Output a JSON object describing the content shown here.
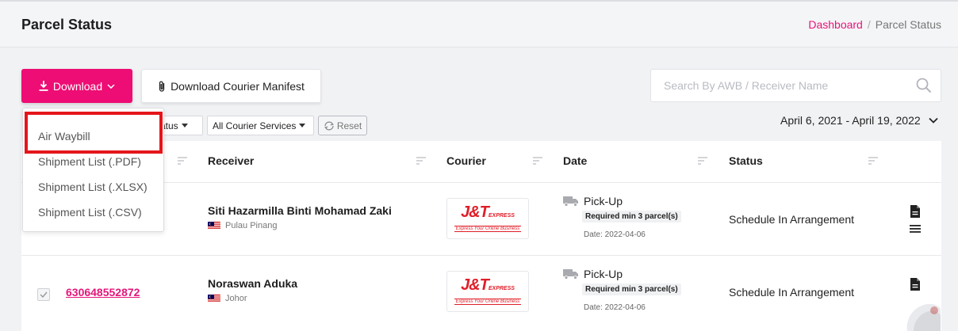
{
  "header": {
    "title": "Parcel Status",
    "breadcrumb": {
      "home": "Dashboard",
      "separator": "/",
      "current": "Parcel Status"
    }
  },
  "toolbar": {
    "download_label": "Download",
    "manifest_label": "Download Courier Manifest",
    "search_placeholder": "Search By AWB / Receiver Name"
  },
  "download_menu": {
    "items": [
      "Air Waybill",
      "Shipment List (.PDF)",
      "Shipment List (.XLSX)",
      "Shipment List (.CSV)"
    ]
  },
  "filters": {
    "status_partial": "atus",
    "courier_services": "All Courier Services",
    "reset_label": "Reset",
    "date_range": "April 6, 2021 - April 19, 2022"
  },
  "table": {
    "columns": [
      "Receiver",
      "Courier",
      "Date",
      "Status"
    ],
    "rows": [
      {
        "awb": "",
        "receiver_name": "Siti Hazarmilla Binti Mohamad Zaki",
        "receiver_state": "Pulau Pinang",
        "courier_logo_text": "J&T",
        "courier_logo_small": "EXPRESS",
        "courier_tagline": "Express Your Online Business",
        "date_type": "Pick-Up",
        "min_parcels": "Required min 3 parcel(s)",
        "date": "Date: 2022-04-06",
        "status": "Schedule In Arrangement"
      },
      {
        "awb": "630648552872",
        "receiver_name": "Noraswan Aduka",
        "receiver_state": "Johor",
        "courier_logo_text": "J&T",
        "courier_logo_small": "EXPRESS",
        "courier_tagline": "Express Your Online Business",
        "date_type": "Pick-Up",
        "min_parcels": "Required min 3 parcel(s)",
        "date": "Date: 2022-04-06",
        "status": "Schedule In Arrangement"
      }
    ]
  },
  "colors": {
    "accent": "#ee0d74",
    "link": "#e5157a",
    "highlight": "#e4161b",
    "courier_brand": "#e01e28"
  },
  "icons": [
    "download-icon",
    "chevron-down-icon",
    "paperclip-icon",
    "search-icon",
    "caret-down-icon",
    "refresh-icon",
    "sort-icon",
    "malaysia-flag-icon",
    "truck-icon",
    "document-icon",
    "menu-icon",
    "checkbox-check-icon"
  ]
}
